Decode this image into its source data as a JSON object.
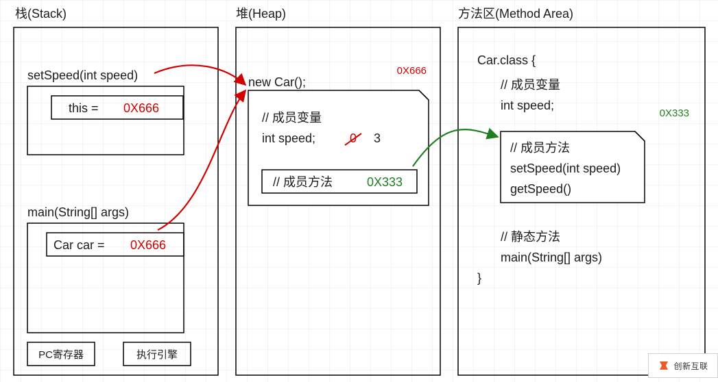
{
  "titles": {
    "stack": "栈(Stack)",
    "heap": "堆(Heap)",
    "methodArea": "方法区(Method Area)"
  },
  "stack": {
    "frame1": {
      "header": "setSpeed(int speed)",
      "var_label": "this =",
      "var_addr": "0X666"
    },
    "frame2": {
      "header": "main(String[] args)",
      "var_label": "Car car =",
      "var_addr": "0X666"
    },
    "pc_register": "PC寄存器",
    "exec_engine": "执行引擎"
  },
  "heap": {
    "new_label": "new Car();",
    "addr": "0X666",
    "field_comment": "// 成员变量",
    "field_decl": "int speed;",
    "field_old": "0",
    "field_new": "3",
    "method_comment": "// 成员方法",
    "method_addr": "0X333"
  },
  "methodArea": {
    "class_open": "Car.class {",
    "field_comment": "// 成员变量",
    "field_decl": "int speed;",
    "addr": "0X333",
    "method_comment": "// 成员方法",
    "method1": "setSpeed(int speed)",
    "method2": "getSpeed()",
    "static_comment": "// 静态方法",
    "static_method": "main(String[] args)",
    "class_close": "}"
  },
  "watermark": "创新互联"
}
